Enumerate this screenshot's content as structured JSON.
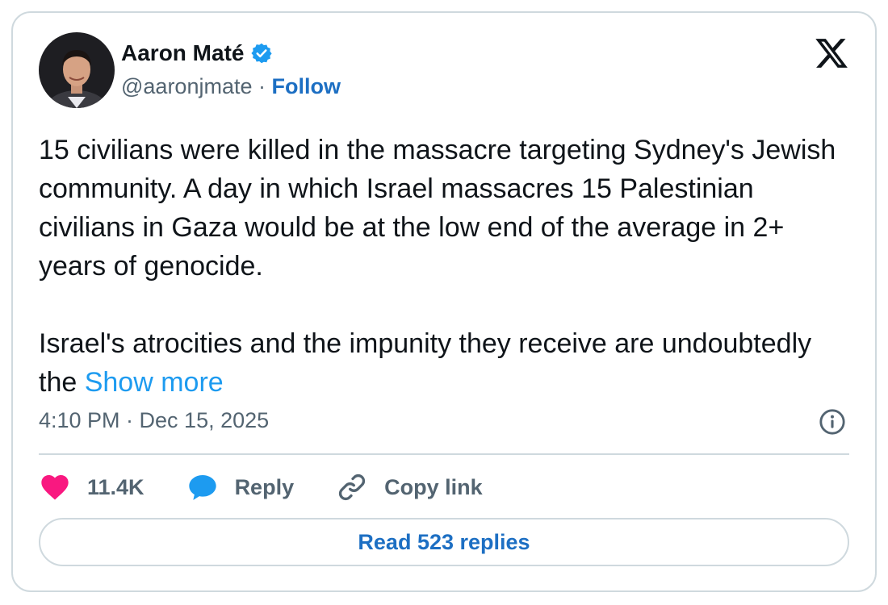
{
  "author": {
    "name": "Aaron Maté",
    "handle": "@aaronjmate",
    "separator": "·",
    "follow_label": "Follow",
    "verified_color": "#1d9bf0"
  },
  "tweet": {
    "paragraph1": "15 civilians were killed in the massacre targeting Sydney's Jewish community. A day in which Israel massacres 15 Palestinian civilians in Gaza would be at the low end of the average in 2+ years of genocide.",
    "paragraph2": "Israel's atrocities and the impunity they receive are undoubtedly the ",
    "show_more_label": "Show more",
    "timestamp": "4:10 PM · Dec 15, 2025"
  },
  "actions": {
    "like_count": "11.4K",
    "reply_label": "Reply",
    "copy_link_label": "Copy link"
  },
  "read_replies_label": "Read 523 replies",
  "icons": {
    "logo": "x-logo-icon",
    "verified": "verified-badge-icon",
    "info": "info-icon",
    "like": "heart-icon",
    "reply": "speech-bubble-icon",
    "copy": "link-icon"
  },
  "colors": {
    "like": "#f91880",
    "reply": "#1d9bf0",
    "link_accent": "#1d9bf0",
    "button_text": "#1d6fc3",
    "muted": "#536471"
  }
}
